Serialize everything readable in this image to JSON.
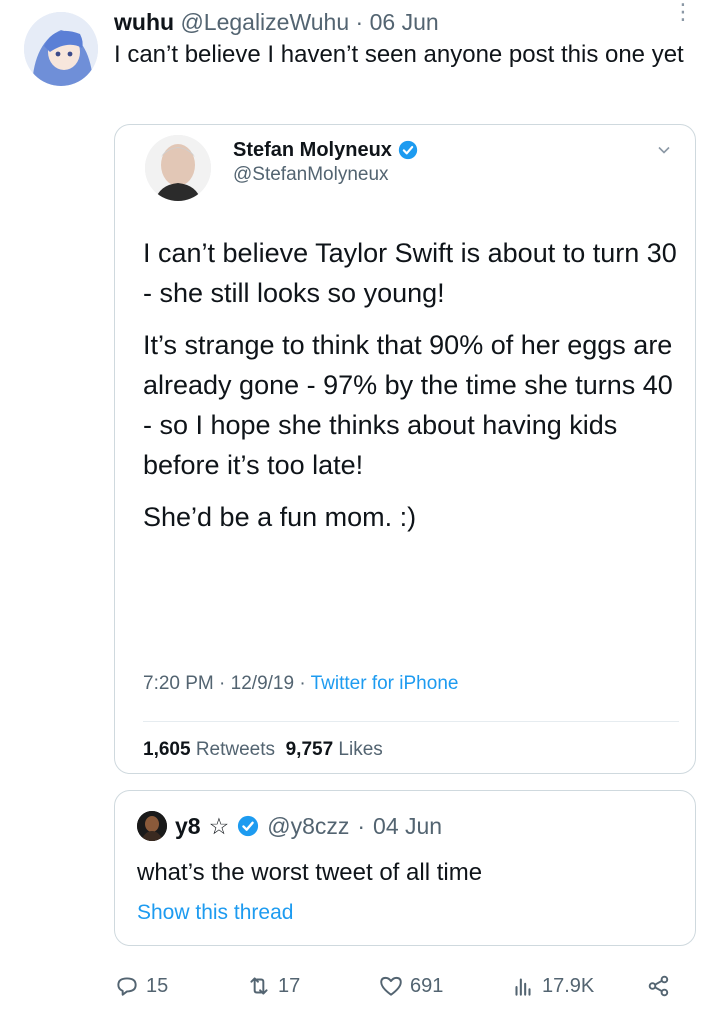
{
  "tweet": {
    "author_name": "wuhu",
    "author_handle": "@LegalizeWuhu",
    "dot": " · ",
    "date": "06 Jun",
    "text": "I can’t believe I haven’t seen anyone post this one yet",
    "more_glyph": "⋮"
  },
  "quoted": {
    "author_name": "Stefan Molyneux",
    "author_handle": "@StefanMolyneux",
    "paragraphs": [
      "I can’t believe Taylor Swift is about to turn 30 - she still looks so young!",
      "It’s strange to think that 90% of her eggs are already gone - 97% by the time she turns 40 - so I hope she thinks about having kids before it’s too late!",
      "She’d be a fun mom. :)"
    ],
    "time": "7:20 PM",
    "date": "12/9/19",
    "source": "Twitter for iPhone",
    "retweets_count": "1,605",
    "retweets_label": "Retweets",
    "likes_count": "9,757",
    "likes_label": "Likes"
  },
  "quoted2": {
    "author_name": "y8",
    "star": "☆",
    "author_handle": "@y8czz",
    "date": "04 Jun",
    "text": "what’s the worst tweet of all time",
    "link": "Show this thread"
  },
  "actions": {
    "replies": "15",
    "retweets": "17",
    "likes": "691",
    "views": "17.9K"
  },
  "colors": {
    "accent": "#1d9bf0",
    "muted": "#536471",
    "border": "#cfd9de"
  }
}
